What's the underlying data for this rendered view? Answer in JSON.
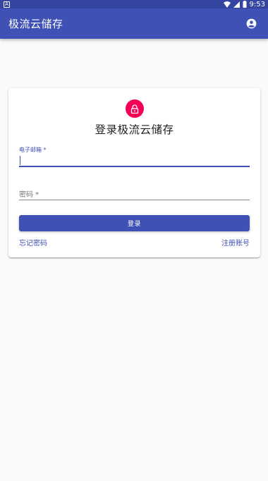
{
  "status_bar": {
    "left_icon": "A",
    "time": "9:53"
  },
  "app_bar": {
    "title": "极流云储存",
    "account_icon": "account-circle-icon"
  },
  "login_card": {
    "lock_icon": "lock-icon",
    "title": "登录极流云储存",
    "email": {
      "label": "电子邮箱 *",
      "value": ""
    },
    "password": {
      "label": "密码 *",
      "value": ""
    },
    "login_button": "登录",
    "forgot_link": "忘记密码",
    "register_link": "注册账号"
  },
  "colors": {
    "primary": "#3f51b5",
    "status_bar": "#3545a1",
    "accent": "#f50057",
    "background": "#fafafa"
  }
}
